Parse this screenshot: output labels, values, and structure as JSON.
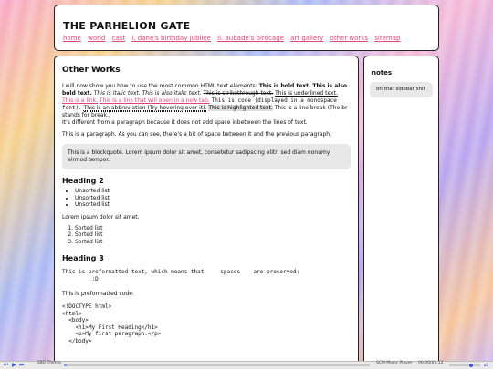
{
  "header": {
    "title": "THE PARHELION GATE",
    "nav": [
      "home",
      "world",
      "cast",
      "i. dane's birthday jubilee",
      "ii. aubade's birdcage",
      "art gallery",
      "other works",
      "sitemap"
    ]
  },
  "main": {
    "heading": "Other Works",
    "para1": {
      "lead": "I will now show you how to use the most common HTML text elements: ",
      "bold": "This is bold text. This is also bold text.",
      "italic": "This is italic text. This is also italic text.",
      "strike": "This is strikethrough text.",
      "underline": "This is underlined text.",
      "link1": "This is a link.",
      "link2": "This is a link that will open in a new tab.",
      "code": "This is code (displayed in a monospace font).",
      "abbr": "This is an abbreviation (Try hovering over it).",
      "highlight": "This is highlighted text.",
      "break1": "This is a line break (The br stands for break.)",
      "break2": "It's different from a paragraph because it does not add space inbetween the lines of text."
    },
    "para2": "This is a paragraph. As you can see, there's a bit of space between it and the previous paragraph.",
    "blockquote": "This is a blockquote. Lorem ipsum dolor sit amet, consetetur sadipscing elitr, sed diam nonumy eirmod tempor.",
    "heading2": "Heading 2",
    "unsorted": [
      "Unsorted list",
      "Unsorted list",
      "Unsorted list"
    ],
    "lorem": "Lorem ipsum dolor sit amet.",
    "sorted": [
      "Sorted list",
      "Sorted list",
      "Sorted list"
    ],
    "heading3": "Heading 3",
    "pre1": "This is preformatted text, which means that     spaces    are preserved:\n         :D",
    "pre_code_label": "This is preformatted code:",
    "pre_code": "<!DOCTYPE html>\n<html>\n  <body>\n    <h1>My First Heading</h1>\n    <p>My first paragraph.</p>\n  </body>"
  },
  "sidebar": {
    "heading": "notes",
    "note": "on that sidebar shit"
  },
  "player": {
    "track": "DBD Theme",
    "player_name": "SCM Music Player",
    "time": "00:00|05:12",
    "progress": 0.01,
    "volume": 0.7
  }
}
